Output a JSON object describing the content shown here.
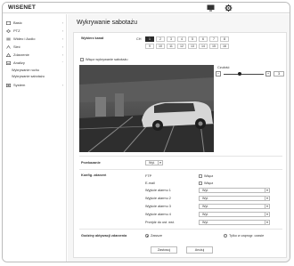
{
  "app": {
    "logo": "WISENET"
  },
  "sidebar": {
    "items": [
      {
        "label": "Basic",
        "icon": "basic-icon"
      },
      {
        "label": "PTZ",
        "icon": "ptz-icon"
      },
      {
        "label": "Wideo i Audio",
        "icon": "video-audio-icon"
      },
      {
        "label": "Sieć",
        "icon": "network-icon"
      },
      {
        "label": "Zdarzenie",
        "icon": "event-icon"
      },
      {
        "label": "Analizy",
        "icon": "analytics-icon"
      },
      {
        "label": "System",
        "icon": "system-icon"
      }
    ],
    "subitems": [
      "Wykrywanie ruchu",
      "Wykrywanie sabotażu"
    ]
  },
  "page": {
    "title": "Wykrywanie sabotażu"
  },
  "channel": {
    "label": "Wybierz kanał",
    "prefix": "CH",
    "row1": [
      "1",
      "2",
      "3",
      "4",
      "5",
      "6",
      "7",
      "8"
    ],
    "row2": [
      "9",
      "10",
      "11",
      "12",
      "13",
      "14",
      "15",
      "16"
    ],
    "active": "1"
  },
  "enable_label": "Włącz wykrywanie sabotażu",
  "sensitivity": {
    "label": "Czułość",
    "value": "3",
    "minus": "−",
    "plus": "+",
    "level": 0.4
  },
  "duration": {
    "label": "Przekazanie",
    "value": "Wył."
  },
  "event_config": {
    "label": "Konfig. zdarzeń",
    "rows": [
      {
        "label": "FTP",
        "type": "check",
        "value": "Włącz"
      },
      {
        "label": "E-mail",
        "type": "check",
        "value": "Włącz"
      },
      {
        "label": "Wyjście alarmu 1",
        "type": "select",
        "value": "Wył."
      },
      {
        "label": "Wyjście alarmu 2",
        "type": "select",
        "value": "Wył."
      },
      {
        "label": "Wyjście alarmu 3",
        "type": "select",
        "value": "Wył."
      },
      {
        "label": "Wyjście alarmu 4",
        "type": "select",
        "value": "Wył."
      },
      {
        "label": "Przejdź do ust. wst.",
        "type": "select",
        "value": "Wył."
      }
    ]
  },
  "schedule": {
    "label": "Godziny aktywacji zdarzenia",
    "option_always": "Zawsze",
    "option_schedule": "Tylko w zaprogr. czasie"
  },
  "buttons": {
    "apply": "Zastosuj",
    "cancel": "Anuluj"
  },
  "colors": {
    "active_channel": "#2b2b2b",
    "panel_bg": "#ffffff",
    "content_bg": "#f6f6f6"
  }
}
